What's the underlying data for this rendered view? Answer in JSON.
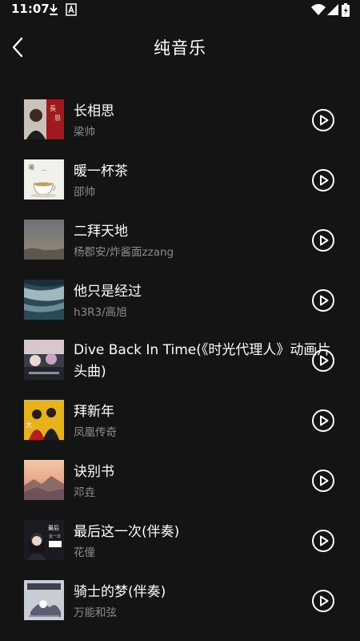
{
  "status_bar": {
    "time": "11:07",
    "icons": [
      "download-icon",
      "a-badge-icon",
      "wifi-icon",
      "signal-icon",
      "battery-icon"
    ]
  },
  "header": {
    "title": "纯音乐",
    "back_icon": "chevron-left-icon"
  },
  "songs": [
    {
      "title": "长相思",
      "artist": "梁帅"
    },
    {
      "title": "暖一杯茶",
      "artist": "邵帅"
    },
    {
      "title": "二拜天地",
      "artist": "杨郡安/炸酱面zzang"
    },
    {
      "title": "他只是经过",
      "artist": "h3R3/高旭"
    },
    {
      "title": "Dive Back In Time(《时光代理人》动画片头曲)",
      "artist": ""
    },
    {
      "title": "拜新年",
      "artist": "凤凰传奇"
    },
    {
      "title": "诀别书",
      "artist": "邓垚"
    },
    {
      "title": "最后这一次(伴奏)",
      "artist": "花僮"
    },
    {
      "title": "骑士的梦(伴奏)",
      "artist": "万能和弦"
    }
  ],
  "colors": {
    "background": "#141414",
    "text_primary": "#ffffff",
    "text_secondary": "#8c8c8c"
  }
}
